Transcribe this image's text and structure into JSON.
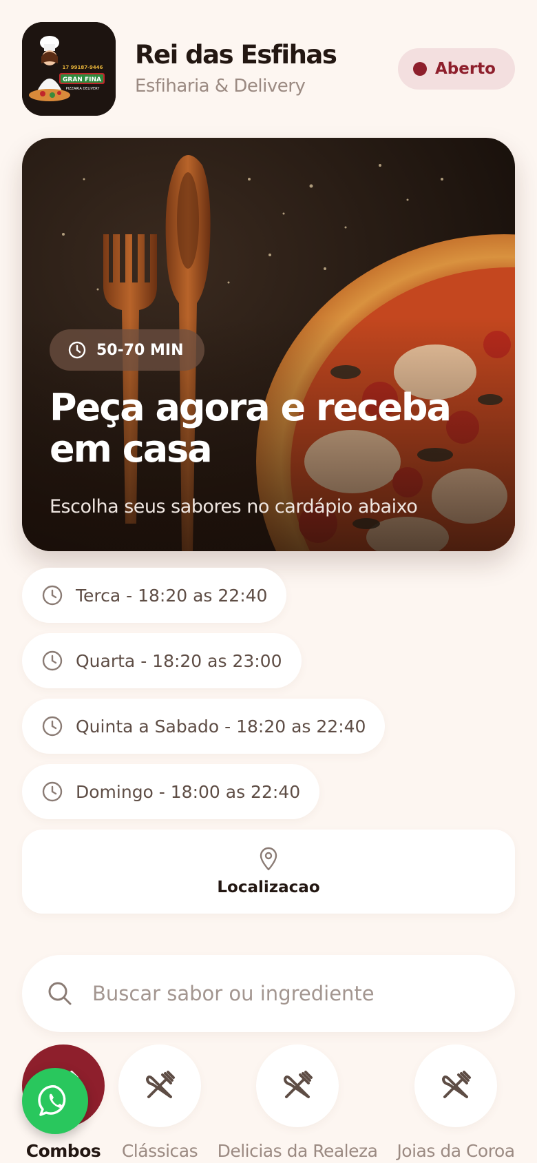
{
  "header": {
    "store_name": "Rei das Esfihas",
    "store_subtitle": "Esfiharia & Delivery",
    "status_label": "Aberto",
    "logo": {
      "phone": "17 99187-9446",
      "brand": "GRAN FINA",
      "tagline": "PIZZARIA DELIVERY"
    }
  },
  "hero": {
    "delivery_time": "50-70 MIN",
    "title": "Peça agora e receba em casa",
    "subtitle": "Escolha seus sabores no cardápio abaixo"
  },
  "hours": [
    "Terca - 18:20 as 22:40",
    "Quarta - 18:20 as 23:00",
    "Quinta a Sabado - 18:20 as 22:40",
    "Domingo - 18:00 as 22:40"
  ],
  "location": {
    "label": "Localizacao"
  },
  "search": {
    "placeholder": "Buscar sabor ou ingrediente",
    "value": ""
  },
  "categories": [
    {
      "label": "Combos",
      "active": true
    },
    {
      "label": "Clássicas",
      "active": false
    },
    {
      "label": "Delicias da Realeza",
      "active": false
    },
    {
      "label": "Joias da Coroa",
      "active": false
    }
  ],
  "colors": {
    "accent": "#8e1f2c",
    "status_bg": "#f3dfdf",
    "background": "#fdf6f1",
    "whatsapp": "#29c75d"
  },
  "icons": {
    "clock": "clock-icon",
    "location": "map-pin-icon",
    "search": "search-icon",
    "category": "fork-knife-icon",
    "whatsapp": "whatsapp-icon"
  }
}
